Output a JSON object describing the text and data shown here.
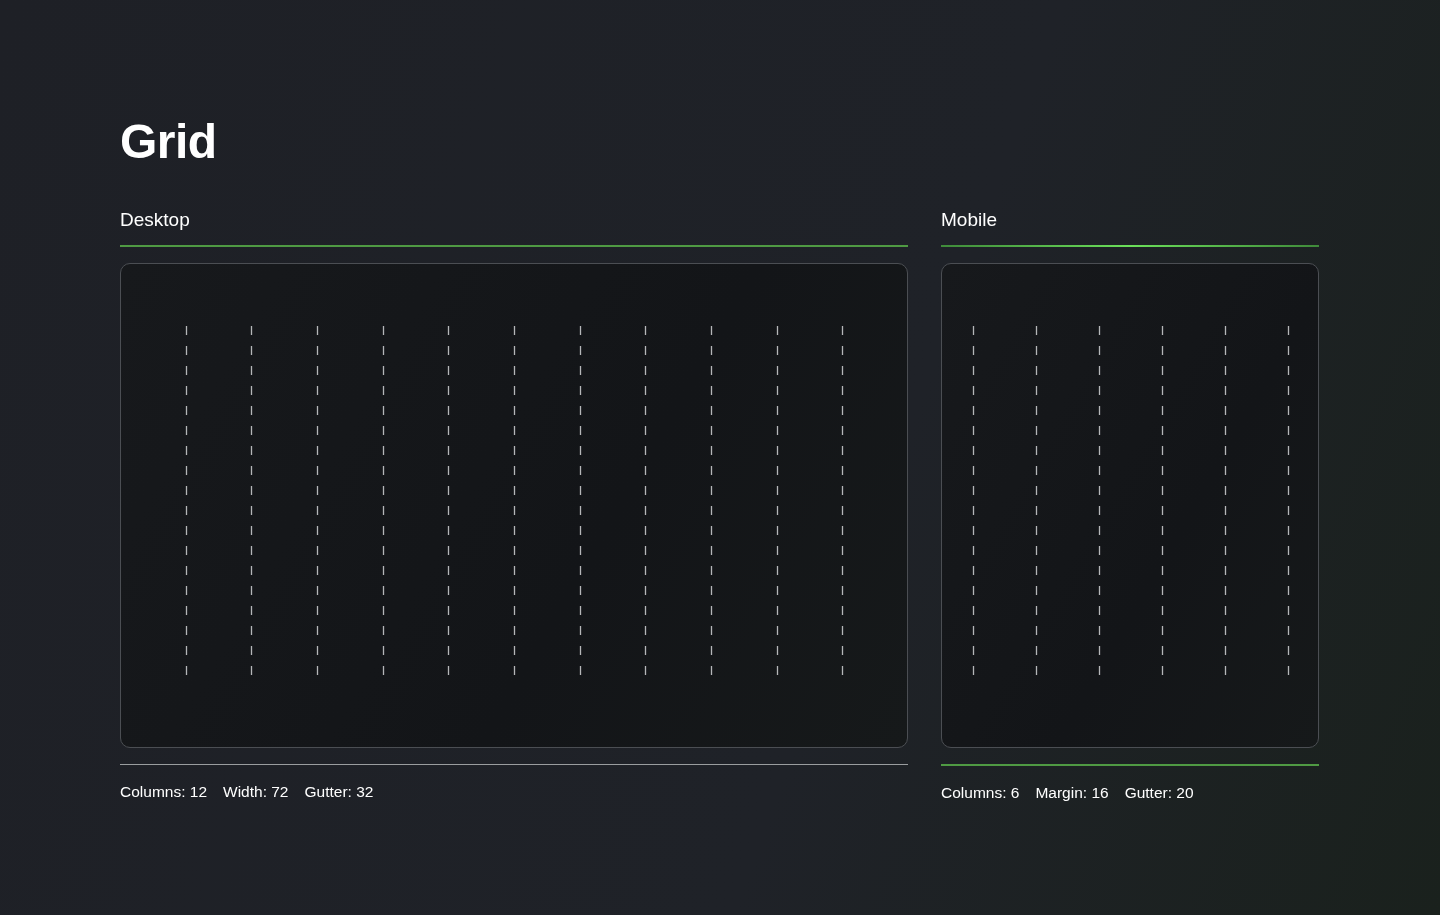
{
  "title": "Grid",
  "panels": [
    {
      "heading": "Desktop",
      "kind": "desktop",
      "specs": [
        "Columns: 12",
        "Width: 72",
        "Gutter: 32"
      ]
    },
    {
      "heading": "Mobile",
      "kind": "mobile",
      "specs": [
        "Columns: 6",
        "Margin: 16",
        "Gutter: 20"
      ]
    }
  ]
}
